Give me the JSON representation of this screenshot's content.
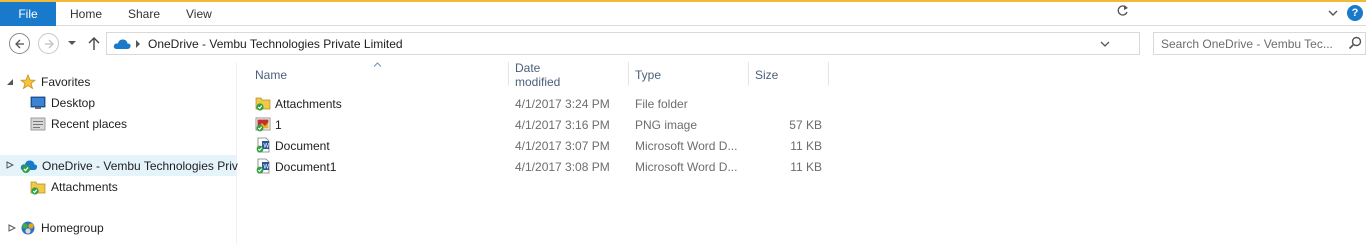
{
  "ribbon": {
    "tabs": [
      "File",
      "Home",
      "Share",
      "View"
    ],
    "help_label": "?"
  },
  "address": {
    "path": "OneDrive - Vembu Technologies Private Limited"
  },
  "search": {
    "placeholder": "Search OneDrive - Vembu Tec..."
  },
  "navpane": {
    "favorites": "Favorites",
    "desktop": "Desktop",
    "recent": "Recent places",
    "onedrive": "OneDrive - Vembu Technologies Priv",
    "attachments": "Attachments",
    "homegroup": "Homegroup"
  },
  "columns": {
    "name": "Name",
    "date": "Date modified",
    "type": "Type",
    "size": "Size"
  },
  "files": [
    {
      "name": "Attachments",
      "date": "4/1/2017 3:24 PM",
      "type": "File folder",
      "size": "",
      "icon": "folder-sync-icon"
    },
    {
      "name": "1",
      "date": "4/1/2017 3:16 PM",
      "type": "PNG image",
      "size": "57 KB",
      "icon": "png-image-icon"
    },
    {
      "name": "Document",
      "date": "4/1/2017 3:07 PM",
      "type": "Microsoft Word D...",
      "size": "11 KB",
      "icon": "word-document-icon"
    },
    {
      "name": "Document1",
      "date": "4/1/2017 3:08 PM",
      "type": "Microsoft Word D...",
      "size": "11 KB",
      "icon": "word-document-icon"
    }
  ],
  "colors": {
    "file_tab": "#1979ca",
    "ribbon_accent": "#f2b936",
    "selection": "#e5f3fb",
    "header_text": "#4c607a"
  }
}
